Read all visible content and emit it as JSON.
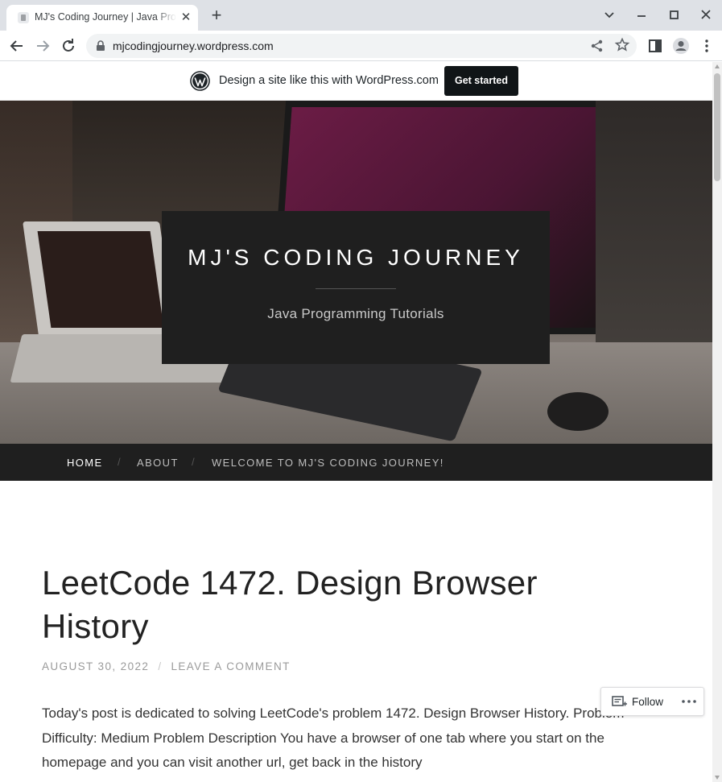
{
  "browser": {
    "tab_title": "MJ's Coding Journey | Java Programming Tutorials",
    "url": "mjcodingjourney.wordpress.com"
  },
  "wp_banner": {
    "text": "Design a site like this with WordPress.com",
    "cta": "Get started"
  },
  "site": {
    "title": "MJ'S CODING JOURNEY",
    "tagline": "Java Programming Tutorials"
  },
  "nav": {
    "items": [
      {
        "label": "HOME",
        "active": true
      },
      {
        "label": "ABOUT",
        "active": false
      },
      {
        "label": "WELCOME TO MJ'S CODING JOURNEY!",
        "active": false
      }
    ],
    "separator": "/"
  },
  "post": {
    "title": "LeetCode 1472. Design Browser History",
    "date": "AUGUST 30, 2022",
    "meta_separator": "/",
    "comment_link": "LEAVE A COMMENT",
    "excerpt": "Today's post is dedicated to solving LeetCode's problem 1472. Design Browser History. Problem Difficulty: Medium Problem Description You have a browser of one tab where you start on the homepage and you can visit another url, get back in the history"
  },
  "follow": {
    "label": "Follow"
  },
  "colors": {
    "nav_bg": "#1f1f1f",
    "title_box_bg": "#1f1f1f",
    "cta_bg": "#101517"
  }
}
